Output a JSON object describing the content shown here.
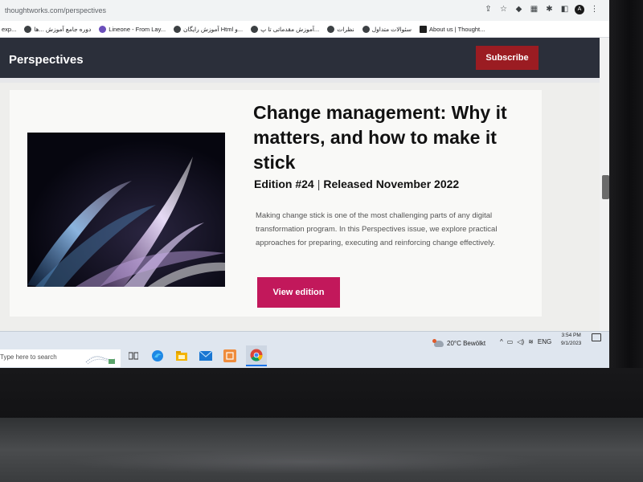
{
  "browser": {
    "url": "thoughtworks.com/perspectives",
    "bookmarks": [
      {
        "label": "exp..."
      },
      {
        "label": "دوره جامع آموزش ...ها"
      },
      {
        "label": "Lineone - From Lay..."
      },
      {
        "label": "آموزش رایگان Html و..."
      },
      {
        "label": "آموزش مقدماتی تا پ..."
      },
      {
        "label": "نظرات"
      },
      {
        "label": "سئوالات متداول"
      },
      {
        "label": "About us | Thought..."
      }
    ]
  },
  "site": {
    "title": "Perspectives",
    "subscribe_label": "Subscribe"
  },
  "hero": {
    "headline": "Change management: Why it matters, and how to make it stick",
    "edition": "Edition #24",
    "released": "Released November 2022",
    "description": "Making change stick is one of the most challenging parts of any digital transformation program. In this Perspectives issue, we explore practical approaches for preparing, executing and reinforcing change effectively.",
    "cta_label": "View edition"
  },
  "taskbar": {
    "search_placeholder": "Type here to search",
    "weather": "20°C  Bewölkt",
    "language": "ENG",
    "time": "3:54 PM",
    "date": "9/1/2023"
  },
  "colors": {
    "header_bg": "#2b2f3a",
    "subscribe_bg": "#9b1c22",
    "cta_bg": "#c2185b"
  }
}
